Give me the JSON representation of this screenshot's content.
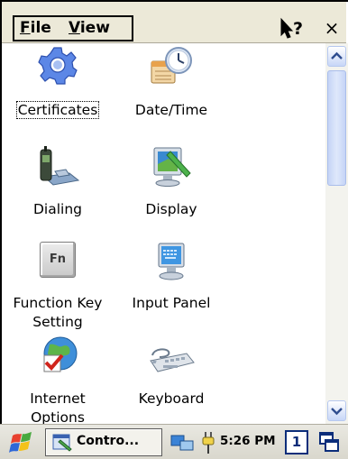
{
  "menu": {
    "file": "File",
    "file_rest": "ile",
    "file_key": "F",
    "view": "View",
    "view_key": "V",
    "view_rest": "iew"
  },
  "titlebar": {
    "help_icon": "help-cursor-icon",
    "close": "×"
  },
  "items": [
    {
      "name": "certificates",
      "label": "Certificates",
      "icon": "certificates-gear-icon",
      "focused": true
    },
    {
      "name": "date-time",
      "label": "Date/Time",
      "icon": "clock-calendar-icon"
    },
    {
      "name": "dialing",
      "label": "Dialing",
      "icon": "phone-dialing-icon"
    },
    {
      "name": "display",
      "label": "Display",
      "icon": "display-monitor-icon"
    },
    {
      "name": "function-key-setting",
      "label_line1": "Function Key",
      "label_line2": "Setting",
      "icon": "fn-key-icon",
      "fn": "Fn"
    },
    {
      "name": "input-panel",
      "label": "Input Panel",
      "icon": "input-panel-icon"
    },
    {
      "name": "internet-options",
      "label_line1": "Internet",
      "label_line2": "Options",
      "icon": "globe-check-icon"
    },
    {
      "name": "keyboard",
      "label": "Keyboard",
      "icon": "keyboard-icon"
    }
  ],
  "scrollbar": {
    "position": 0
  },
  "taskbar": {
    "task_label": "Contro...",
    "clock": "5:26 PM",
    "input_indicator": "1"
  }
}
